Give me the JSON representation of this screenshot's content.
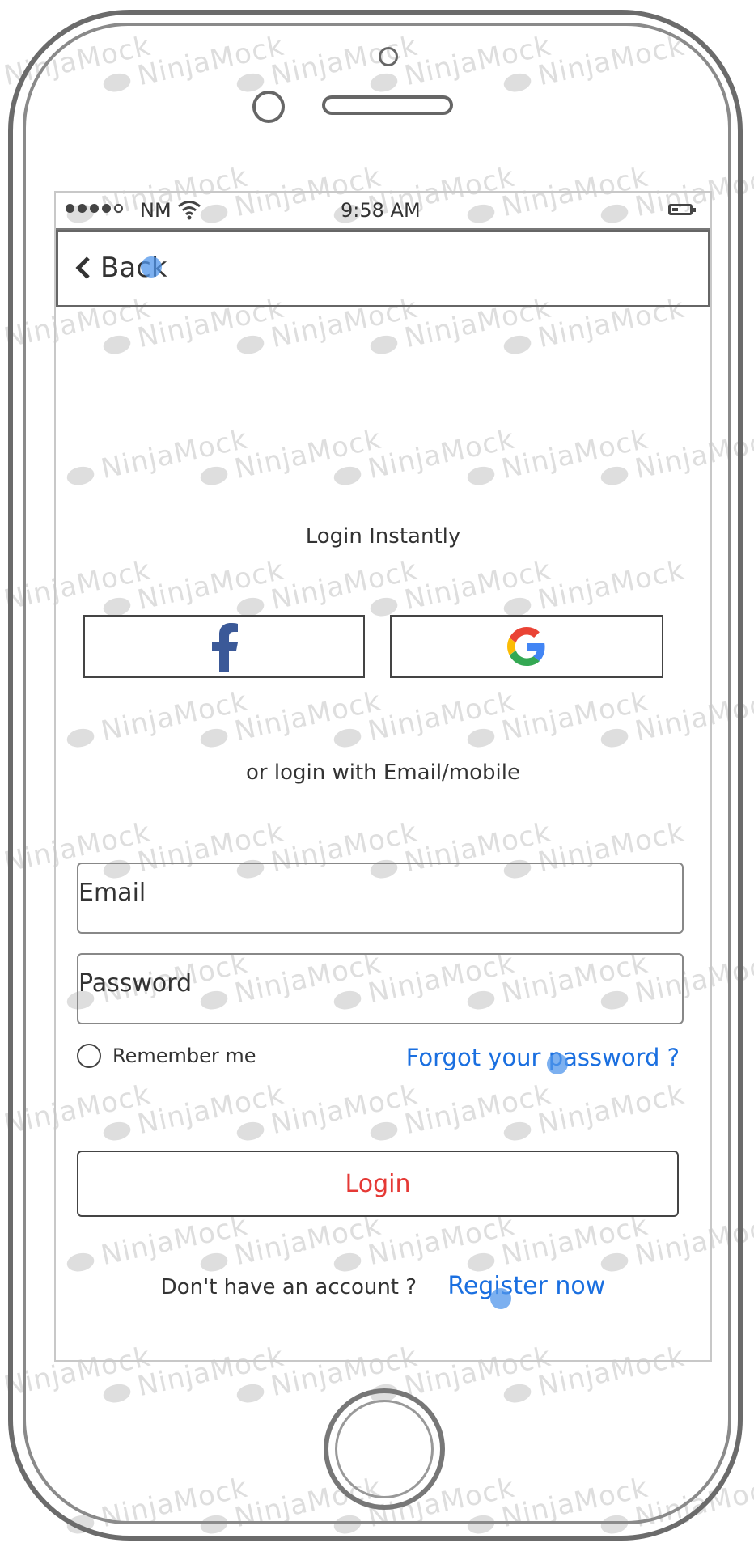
{
  "watermark": "NinjaMock",
  "statusbar": {
    "carrier": "NM",
    "time": "9:58 AM"
  },
  "navbar": {
    "back_label": "Back"
  },
  "login": {
    "heading": "Login Instantly",
    "social": [
      {
        "name": "facebook",
        "icon": "facebook-icon"
      },
      {
        "name": "google",
        "icon": "google-icon"
      }
    ],
    "divider_text": "or login with Email/mobile",
    "email_placeholder": "Email",
    "password_placeholder": "Password",
    "remember_label": "Remember me",
    "forgot_label": "Forgot your password ?",
    "submit_label": "Login",
    "no_account_text": "Don't have an account ?",
    "register_label": "Register now"
  },
  "colors": {
    "link": "#1a6fe0",
    "login_text": "#e53935",
    "facebook": "#3b5998"
  }
}
